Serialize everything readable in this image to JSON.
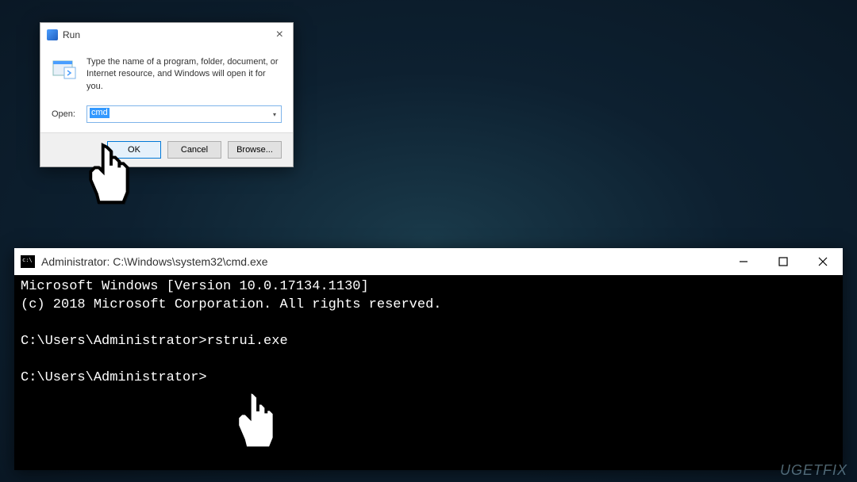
{
  "run_dialog": {
    "title": "Run",
    "description": "Type the name of a program, folder, document, or Internet resource, and Windows will open it for you.",
    "open_label": "Open:",
    "input_value": "cmd",
    "buttons": {
      "ok": "OK",
      "cancel": "Cancel",
      "browse": "Browse..."
    }
  },
  "cmd_window": {
    "title": "Administrator: C:\\Windows\\system32\\cmd.exe",
    "line1": "Microsoft Windows [Version 10.0.17134.1130]",
    "line2": "(c) 2018 Microsoft Corporation. All rights reserved.",
    "prompt1": "C:\\Users\\Administrator>",
    "command1": "rstrui.exe",
    "prompt2": "C:\\Users\\Administrator>"
  },
  "watermark": "UGETFIX"
}
